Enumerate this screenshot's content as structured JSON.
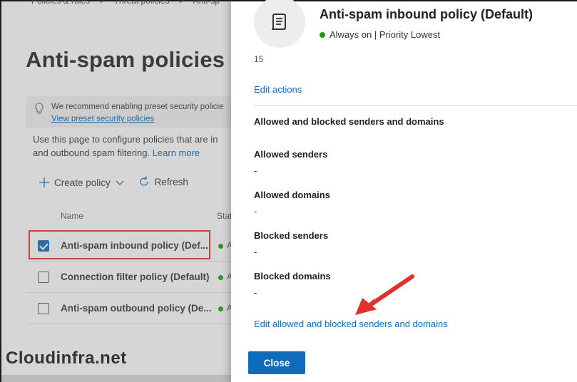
{
  "background": {
    "breadcrumb": [
      "Policies & rules",
      ">",
      "Threat policies",
      ">",
      "Anti-sp"
    ],
    "page_title": "Anti-spam policies",
    "info": {
      "text": "We recommend enabling preset security policie",
      "link": "View preset security policies"
    },
    "description_line1": "Use this page to configure policies that are in",
    "description_line2": "and outbound spam filtering.",
    "learn_more": "Learn more",
    "toolbar": {
      "create_policy": "Create policy",
      "refresh": "Refresh"
    },
    "columns": {
      "name": "Name",
      "status": "Stat"
    },
    "rows": [
      {
        "name": "Anti-spam inbound policy (Def...",
        "status": "A",
        "checked": true
      },
      {
        "name": "Connection filter policy (Default)",
        "status": "A",
        "checked": false
      },
      {
        "name": "Anti-spam outbound policy (De...",
        "status": "A",
        "checked": false
      }
    ],
    "watermark": "Cloudinfra.net"
  },
  "panel": {
    "title": "Anti-spam inbound policy (Default)",
    "status": "Always on | Priority Lowest",
    "cut_text": "15",
    "edit_actions": "Edit actions",
    "section_title": "Allowed and blocked senders and domains",
    "fields": [
      {
        "label": "Allowed senders",
        "value": "-"
      },
      {
        "label": "Allowed domains",
        "value": "-"
      },
      {
        "label": "Blocked senders",
        "value": "-"
      },
      {
        "label": "Blocked domains",
        "value": "-"
      }
    ],
    "edit_link": "Edit allowed and blocked senders and domains",
    "close": "Close"
  },
  "colors": {
    "accent": "#0f6cbd",
    "highlight": "#e0312f",
    "status_green": "#13a10e"
  },
  "icons": [
    "lightbulb-icon",
    "plus-icon",
    "chevron-down-icon",
    "refresh-icon",
    "scroll-icon",
    "status-dot-icon",
    "arrow-annotation"
  ]
}
